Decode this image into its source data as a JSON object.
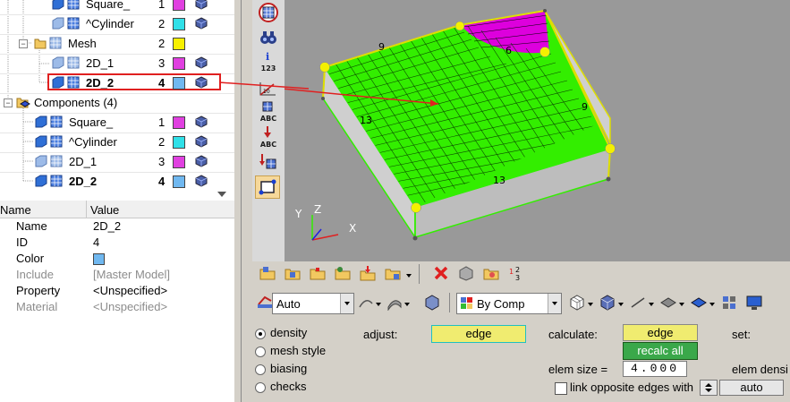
{
  "tree": {
    "rows": [
      {
        "label": "Square_",
        "id": "1",
        "color": "#e040e0",
        "bold": false
      },
      {
        "label": "^Cylinder",
        "id": "2",
        "color": "#30e0e8",
        "bold": false
      },
      {
        "label": "Mesh",
        "id": "2",
        "color": "#f8f000",
        "bold": false
      },
      {
        "label": "2D_1",
        "id": "3",
        "color": "#e040e0",
        "bold": false
      },
      {
        "label": "2D_2",
        "id": "4",
        "color": "#70b8f0",
        "bold": true
      },
      {
        "label": "Components (4)",
        "id": "",
        "color": "",
        "bold": false
      },
      {
        "label": "Square_",
        "id": "1",
        "color": "#e040e0",
        "bold": false
      },
      {
        "label": "^Cylinder",
        "id": "2",
        "color": "#30e0e8",
        "bold": false
      },
      {
        "label": "2D_1",
        "id": "3",
        "color": "#e040e0",
        "bold": false
      },
      {
        "label": "2D_2",
        "id": "4",
        "color": "#70b8f0",
        "bold": true
      }
    ]
  },
  "properties": {
    "header_name": "Name",
    "header_value": "Value",
    "rows": [
      {
        "name": "Name",
        "value": "2D_2",
        "muted": false
      },
      {
        "name": "ID",
        "value": "4",
        "muted": false
      },
      {
        "name": "Color",
        "value": "",
        "muted": false
      },
      {
        "name": "Include",
        "value": "[Master Model]",
        "muted": true
      },
      {
        "name": "Property",
        "value": "<Unspecified>",
        "muted": false
      },
      {
        "name": "Material",
        "value": "<Unspecified>",
        "muted": true
      }
    ],
    "color_value": "#70b8f0"
  },
  "toolbar": {
    "labels": [
      "123",
      "ABC",
      "ABC"
    ]
  },
  "viewport": {
    "edge_labels": [
      "9",
      "6",
      "9",
      "13",
      "13"
    ],
    "axes": {
      "x": "X",
      "y": "Y",
      "z": "Z"
    },
    "colors": {
      "mesh": "#33ee00",
      "highlight": "#dd00dd",
      "node": "#f4f000",
      "background": "#999999"
    }
  },
  "panel": {
    "auto_combo": "Auto",
    "bycomp_combo": "By Comp",
    "radios": [
      {
        "label": "density",
        "selected": true
      },
      {
        "label": "mesh style",
        "selected": false
      },
      {
        "label": "biasing",
        "selected": false
      },
      {
        "label": "checks",
        "selected": false
      }
    ],
    "adjust_label": "adjust:",
    "adjust_value": "edge",
    "calculate_label": "calculate:",
    "calculate_value": "edge",
    "recalc_label": "recalc all",
    "set_label": "set:",
    "elem_size_label": "elem size =",
    "elem_size_value": "4.000",
    "elem_density_label": "elem densi",
    "link_label": "link opposite edges with",
    "auto_button": "auto"
  }
}
